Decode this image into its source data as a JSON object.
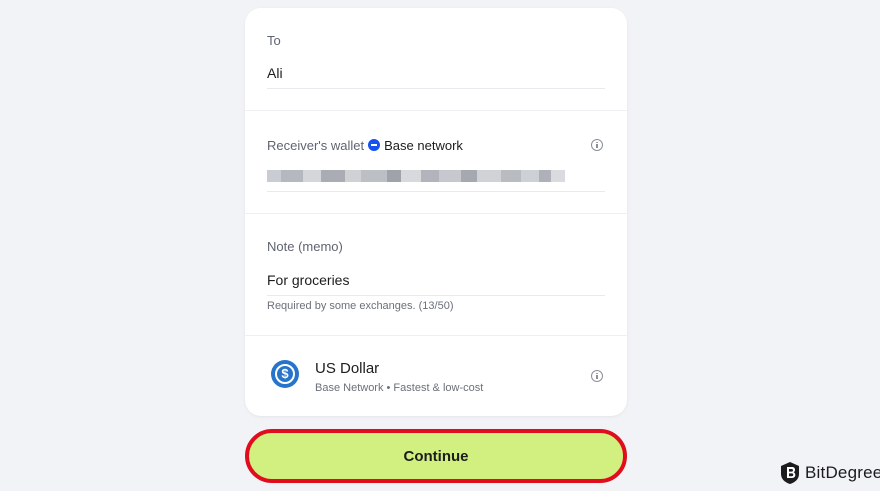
{
  "form": {
    "to": {
      "label": "To",
      "value": "Ali"
    },
    "wallet": {
      "label": "Receiver's wallet",
      "network_name": "Base network",
      "network_icon": "base-network-icon",
      "info_icon": "info-icon"
    },
    "memo": {
      "label": "Note (memo)",
      "value": "For groceries",
      "helper": "Required by some exchanges. (13/50)"
    },
    "currency": {
      "icon": "usdc-icon",
      "name": "US Dollar",
      "subtitle": "Base Network • Fastest & low-cost",
      "info_icon": "info-icon"
    }
  },
  "actions": {
    "continue_label": "Continue"
  },
  "watermark": {
    "brand": "BitDegree"
  },
  "colors": {
    "page_bg": "#f2f3f7",
    "card_bg": "#ffffff",
    "button_fill": "#d2f07f",
    "highlight_border": "#e00d1e",
    "usdc_blue": "#2775ca",
    "base_blue": "#1652f0"
  }
}
